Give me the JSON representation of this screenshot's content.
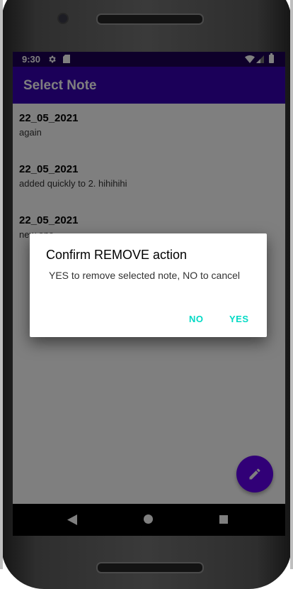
{
  "status_bar": {
    "time": "9:30"
  },
  "app_bar": {
    "title": "Select Note"
  },
  "notes": [
    {
      "title": "22_05_2021",
      "body": "again"
    },
    {
      "title": "22_05_2021",
      "body": "added quickly to 2. hihihihi"
    },
    {
      "title": "22_05_2021",
      "body": "new one"
    }
  ],
  "dialog": {
    "title": "Confirm REMOVE action",
    "message": "YES to remove selected note, NO to cancel",
    "negative_label": "NO",
    "positive_label": "YES"
  },
  "fab": {
    "icon": "pencil-icon"
  },
  "nav": {
    "icons": [
      "back-icon",
      "home-icon",
      "recents-icon"
    ]
  },
  "colors": {
    "status_bar": "#1d0054",
    "app_bar": "#3700b3",
    "accent": "#03dac5",
    "fab": "#6200ee"
  }
}
